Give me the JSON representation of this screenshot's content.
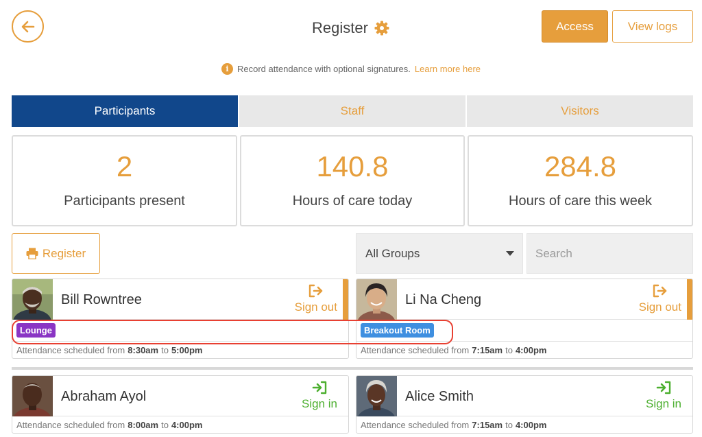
{
  "header": {
    "title": "Register",
    "access_label": "Access",
    "logs_label": "View logs"
  },
  "info": {
    "text": "Record attendance with optional signatures.",
    "link": "Learn more here"
  },
  "tabs": [
    {
      "label": "Participants",
      "active": true
    },
    {
      "label": "Staff",
      "active": false
    },
    {
      "label": "Visitors",
      "active": false
    }
  ],
  "stats": [
    {
      "value": "2",
      "label": "Participants present"
    },
    {
      "value": "140.8",
      "label": "Hours of care today"
    },
    {
      "value": "284.8",
      "label": "Hours of care this week"
    }
  ],
  "controls": {
    "register_label": "Register",
    "group_selected": "All Groups",
    "search_placeholder": "Search"
  },
  "cards": [
    {
      "name": "Bill Rowntree",
      "action": "Sign out",
      "group": {
        "label": "Lounge",
        "color": "#8a35c4"
      },
      "schedule": {
        "prefix": "Attendance scheduled from",
        "from": "8:30am",
        "to_word": "to",
        "to": "5:00pm"
      }
    },
    {
      "name": "Li Na Cheng",
      "action": "Sign out",
      "group": {
        "label": "Breakout Room",
        "color": "#3f8fe0"
      },
      "schedule": {
        "prefix": "Attendance scheduled from",
        "from": "7:15am",
        "to_word": "to",
        "to": "4:00pm"
      }
    },
    {
      "name": "Abraham Ayol",
      "action": "Sign in",
      "schedule": {
        "prefix": "Attendance scheduled from",
        "from": "8:00am",
        "to_word": "to",
        "to": "4:00pm"
      }
    },
    {
      "name": "Alice Smith",
      "action": "Sign in",
      "schedule": {
        "prefix": "Attendance scheduled from",
        "from": "7:15am",
        "to_word": "to",
        "to": "4:00pm"
      }
    }
  ],
  "colors": {
    "accent": "#e69e3c",
    "primary": "#11478b",
    "sign_in": "#4caf2f",
    "highlight": "#e84032"
  }
}
